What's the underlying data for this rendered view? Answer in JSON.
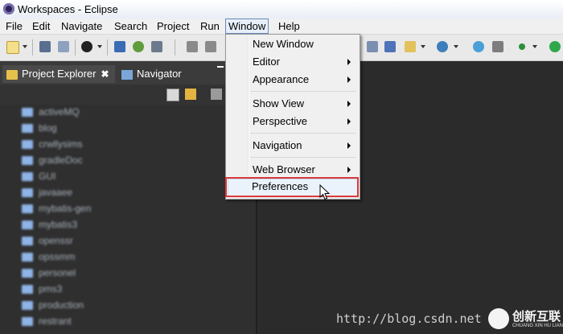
{
  "window": {
    "title": "Workspaces - Eclipse"
  },
  "menubar": {
    "items": [
      "File",
      "Edit",
      "Navigate",
      "Search",
      "Project",
      "Run",
      "Window",
      "Help"
    ],
    "active": "Window"
  },
  "window_menu": {
    "items": [
      {
        "label": "New Window",
        "submenu": false
      },
      {
        "label": "Editor",
        "submenu": true
      },
      {
        "label": "Appearance",
        "submenu": true
      },
      {
        "label": "Show View",
        "submenu": true
      },
      {
        "label": "Perspective",
        "submenu": true
      },
      {
        "label": "Navigation",
        "submenu": true
      },
      {
        "label": "Web Browser",
        "submenu": true
      },
      {
        "label": "Preferences",
        "submenu": false
      }
    ],
    "highlighted": "Preferences"
  },
  "views": {
    "project_explorer": {
      "label": "Project Explorer",
      "close_glyph": "✖"
    },
    "navigator": {
      "label": "Navigator"
    }
  },
  "projects": [
    "activeMQ",
    "blog",
    "crwllysims",
    "gradleDoc",
    "GUI",
    "javaaee",
    "mybatis-gen",
    "mybatis3",
    "openssr",
    "opssmm",
    "personel",
    "pms3",
    "production",
    "restrant"
  ],
  "watermark": {
    "url": "http://blog.csdn.net",
    "brand_name": "创新互联",
    "brand_sub": "CHUANG XIN HU LIAN"
  },
  "colors": {
    "highlight_border": "#d9393b",
    "dark_bg": "#2b2b2b",
    "menu_bg": "#f0f0f0"
  }
}
